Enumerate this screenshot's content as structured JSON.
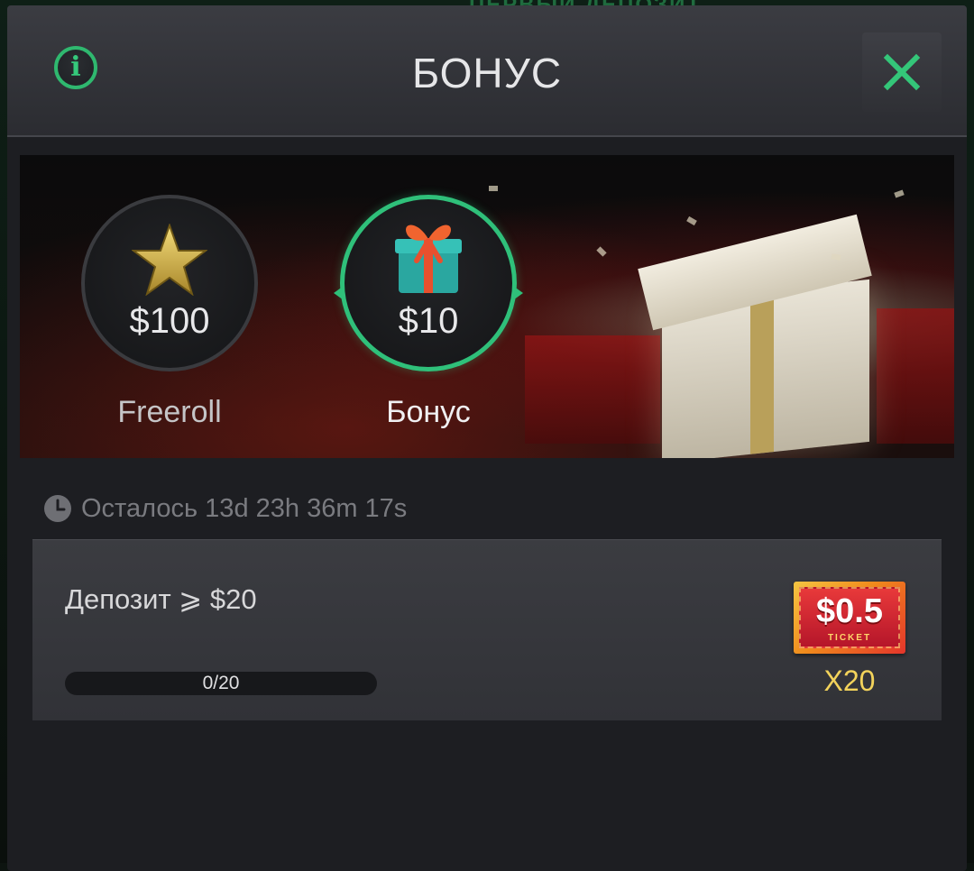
{
  "backdrop": {
    "strip_text": "ПЕРВЫЙ ДЕПОЗИТ"
  },
  "header": {
    "title": "БОНУС",
    "info_icon": "info-icon",
    "close_icon": "close-icon"
  },
  "tiers": [
    {
      "amount": "$100",
      "label": "Freeroll",
      "icon": "star-icon"
    },
    {
      "amount": "$10",
      "label": "Бонус",
      "icon": "gift-icon",
      "selected": true
    }
  ],
  "timer": {
    "text": "Осталось 13d 23h 36m 17s",
    "icon": "clock-icon"
  },
  "task": {
    "title": "Депозит ⩾ $20",
    "progress_text": "0/20",
    "progress_fraction": 0,
    "reward": {
      "value": "$0.5",
      "ticket_word": "TICKET",
      "multiplier": "X20"
    }
  },
  "colors": {
    "accent": "#2fc07a",
    "multiplier": "#f3d35b",
    "background": "#1d1e22"
  }
}
